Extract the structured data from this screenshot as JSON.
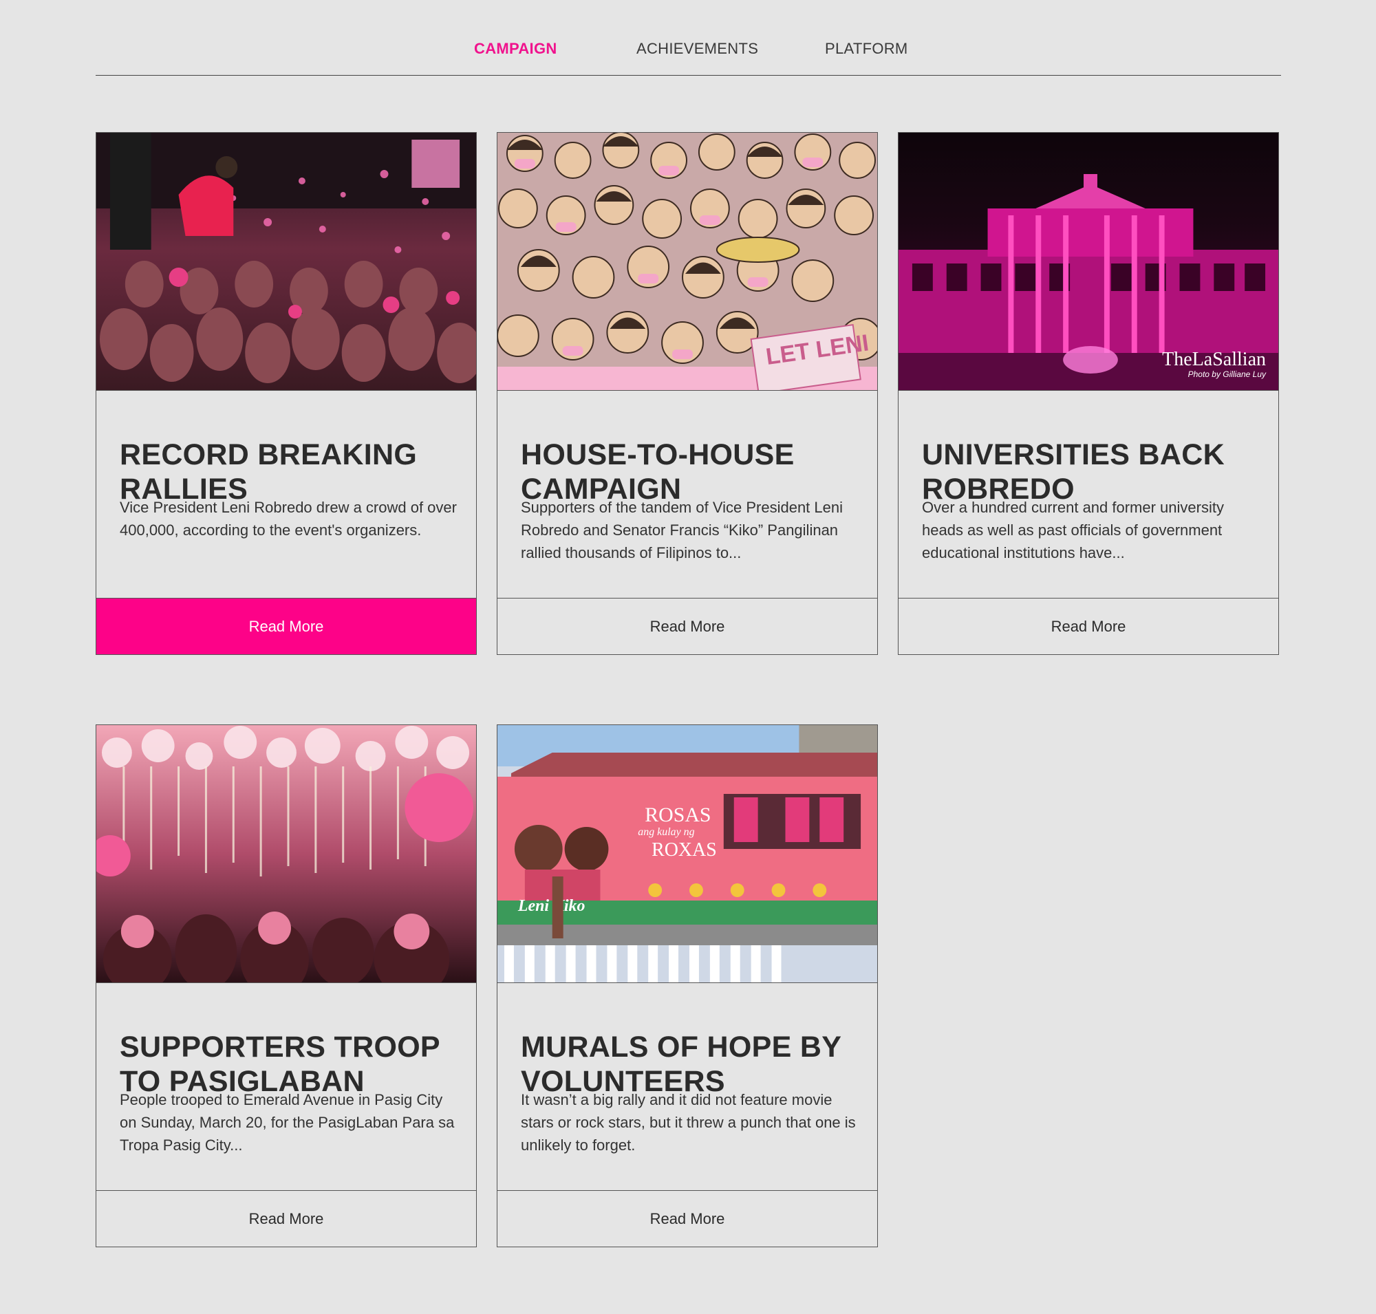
{
  "tabs": [
    {
      "label": "CAMPAIGN",
      "active": true
    },
    {
      "label": "ACHIEVEMENTS",
      "active": false
    },
    {
      "label": "PLATFORM",
      "active": false
    }
  ],
  "colors": {
    "accent": "#fd0288",
    "tab_active": "#f0138d",
    "background": "#e5e5e5",
    "text": "#2b2b2b"
  },
  "cards": [
    {
      "title": "RECORD BREAKING RALLIES",
      "description": "Vice President Leni Robredo drew a crowd of over 400,000, according to the event's organizers.",
      "read_more": "Read More"
    },
    {
      "title": "HOUSE-TO-HOUSE CAMPAIGN",
      "description": "Supporters of the tandem of Vice President Leni Robredo and Senator Francis “Kiko” Pangilinan rallied thousands of Filipinos to...",
      "read_more": "Read More",
      "image_sign": "LET LENI"
    },
    {
      "title": "UNIVERSITIES BACK ROBREDO",
      "description": "Over a hundred current and former university heads as well as past officials of government educational institutions have...",
      "read_more": "Read More",
      "watermark_brand": "TheLaSallian",
      "watermark_credit": "Photo by Gilliane Luy"
    },
    {
      "title": "SUPPORTERS TROOP TO PASIGLABAN",
      "description": "People trooped to Emerald Avenue in Pasig City on Sunday, March 20, for the PasigLaban Para sa Tropa Pasig City...",
      "read_more": "Read More"
    },
    {
      "title": "MURALS OF HOPE BY VOLUNTEERS",
      "description": "It wasn’t a big rally and it did not feature movie stars or rock stars, but it threw a punch that one is unlikely to forget.",
      "read_more": "Read More",
      "mural_text_1": "ROSAS",
      "mural_text_2": "ang kulay ng",
      "mural_text_3": "ROXAS",
      "mural_text_4": "Leni Kiko"
    }
  ]
}
